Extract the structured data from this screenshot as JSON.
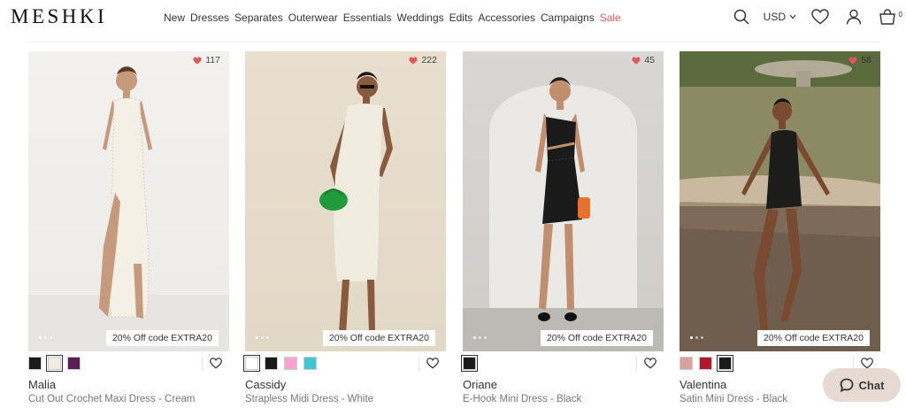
{
  "header": {
    "logo": "MESHKI",
    "nav": [
      "New",
      "Dresses",
      "Separates",
      "Outerwear",
      "Essentials",
      "Weddings",
      "Edits",
      "Accessories",
      "Campaigns",
      "Sale"
    ],
    "currency": "USD",
    "cart_count": "0"
  },
  "products": [
    {
      "likes": "117",
      "promo": "20% Off code EXTRA20",
      "name": "Malia",
      "desc": "Cut Out Crochet Maxi Dress - Cream",
      "swatches": [
        "#1a1a1a",
        "#efece5",
        "#5b1d55"
      ]
    },
    {
      "likes": "222",
      "promo": "20% Off code EXTRA20",
      "name": "Cassidy",
      "desc": "Strapless Midi Dress - White",
      "swatches": [
        "#ffffff",
        "#1a1a1a",
        "#f5a3cf",
        "#3ec6d6"
      ]
    },
    {
      "likes": "45",
      "promo": "20% Off code EXTRA20",
      "name": "Oriane",
      "desc": "E-Hook Mini Dress - Black",
      "swatches": [
        "#1a1a1a"
      ]
    },
    {
      "likes": "58",
      "promo": "20% Off code EXTRA20",
      "name": "Valentina",
      "desc": "Satin Mini Dress - Black",
      "swatches": [
        "#d9a39b",
        "#b3162c",
        "#1a1a1a"
      ]
    }
  ],
  "chat": {
    "label": "Chat"
  },
  "colors": {
    "sale": "#e0585b",
    "heart": "#e0585b",
    "chat_bg": "#e6dad2"
  }
}
